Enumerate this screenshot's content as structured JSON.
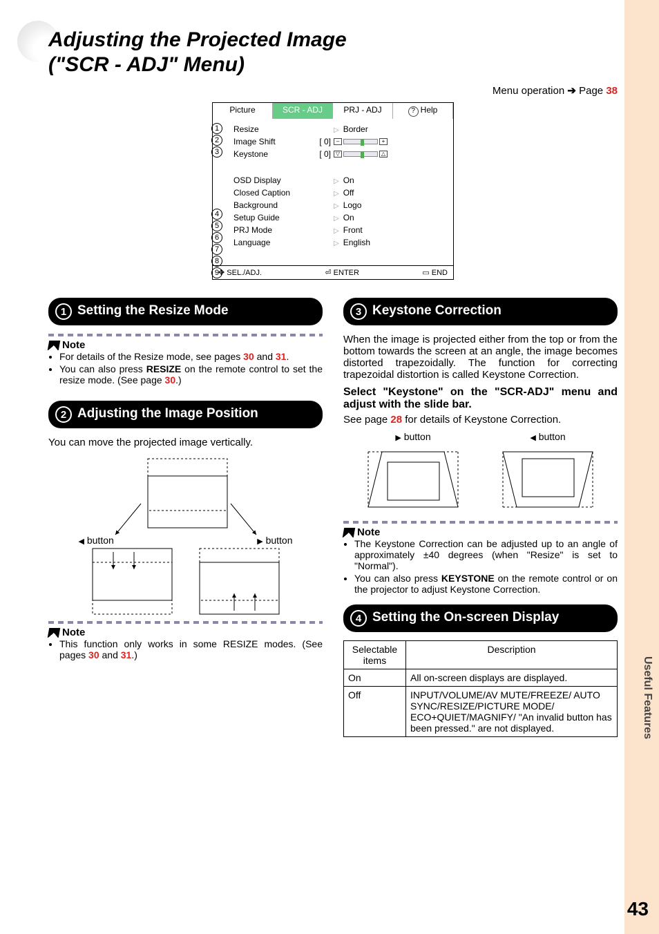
{
  "title_line1": "Adjusting the Projected Image",
  "title_line2": "(\"SCR - ADJ\" Menu)",
  "menu_operation_label": "Menu operation",
  "menu_operation_page_label": "Page",
  "menu_operation_page": "38",
  "menu": {
    "tabs": [
      "Picture",
      "SCR - ADJ",
      "PRJ - ADJ",
      "Help"
    ],
    "rows_group1": [
      {
        "n": "1",
        "label": "Resize",
        "val": "Border",
        "arrow": true,
        "slider": false,
        "pre": ""
      },
      {
        "n": "2",
        "label": "Image Shift",
        "val": "",
        "arrow": false,
        "slider": true,
        "pre": "[        0]",
        "icon": "shift"
      },
      {
        "n": "3",
        "label": "Keystone",
        "val": "",
        "arrow": false,
        "slider": true,
        "pre": "[        0]",
        "icon": "trap"
      }
    ],
    "rows_group2": [
      {
        "n": "4",
        "label": "OSD Display",
        "val": "On"
      },
      {
        "n": "5",
        "label": "Closed Caption",
        "val": "Off"
      },
      {
        "n": "6",
        "label": "Background",
        "val": "Logo"
      },
      {
        "n": "7",
        "label": "Setup Guide",
        "val": "On"
      },
      {
        "n": "8",
        "label": "PRJ Mode",
        "val": "Front"
      },
      {
        "n": "9",
        "label": "Language",
        "val": "English"
      }
    ],
    "footer": {
      "sel": "SEL./ADJ.",
      "enter": "ENTER",
      "end": "END"
    }
  },
  "s1": {
    "title": "Setting the Resize Mode",
    "note_label": "Note",
    "bullets": [
      {
        "pre": "For details of the Resize mode, see pages ",
        "r1": "30",
        "mid": " and ",
        "r2": "31",
        "post": "."
      },
      {
        "pre": "You can also press ",
        "bold": "RESIZE",
        "mid": " on the remote control to set the resize mode. (See page ",
        "r1": "30",
        "post": ".)"
      }
    ]
  },
  "s2": {
    "title": "Adjusting the Image Position",
    "desc": "You can move the projected image vertically.",
    "left_btn": "button",
    "right_btn": "button",
    "note_label": "Note",
    "bullets": [
      {
        "pre": "This function only works in some RESIZE modes. (See pages ",
        "r1": "30",
        "mid": " and ",
        "r2": "31",
        "post": ".)"
      }
    ]
  },
  "s3": {
    "title": "Keystone Correction",
    "desc": "When the image is projected either from the top or from the bottom towards the screen at an angle, the image becomes distorted trapezoidally. The function for correcting trapezoidal distortion is called Keystone Correction.",
    "subhead": "Select \"Keystone\" on the \"SCR-ADJ\" menu and adjust with the slide bar.",
    "seepage_pre": "See page ",
    "seepage_ref": "28",
    "seepage_post": " for details of Keystone Correction.",
    "left_btn": "button",
    "right_btn": "button",
    "note_label": "Note",
    "bullets": [
      {
        "text": "The Keystone Correction can be adjusted up to an angle of approximately ±40 degrees (when \"Resize\" is set to \"Normal\")."
      },
      {
        "pre": "You can also press ",
        "bold": "KEYSTONE",
        "post": " on the remote control or on the projector to adjust Keystone Correction."
      }
    ]
  },
  "s4": {
    "title": "Setting the On-screen Display",
    "table": {
      "head": [
        "Selectable items",
        "Description"
      ],
      "rows": [
        [
          "On",
          "All on-screen displays are displayed."
        ],
        [
          "Off",
          "INPUT/VOLUME/AV MUTE/FREEZE/ AUTO SYNC/RESIZE/PICTURE MODE/ ECO+QUIET/MAGNIFY/ \"An invalid button has been pressed.\" are not displayed."
        ]
      ]
    }
  },
  "side_tab": "Useful Features",
  "page_number": "43"
}
